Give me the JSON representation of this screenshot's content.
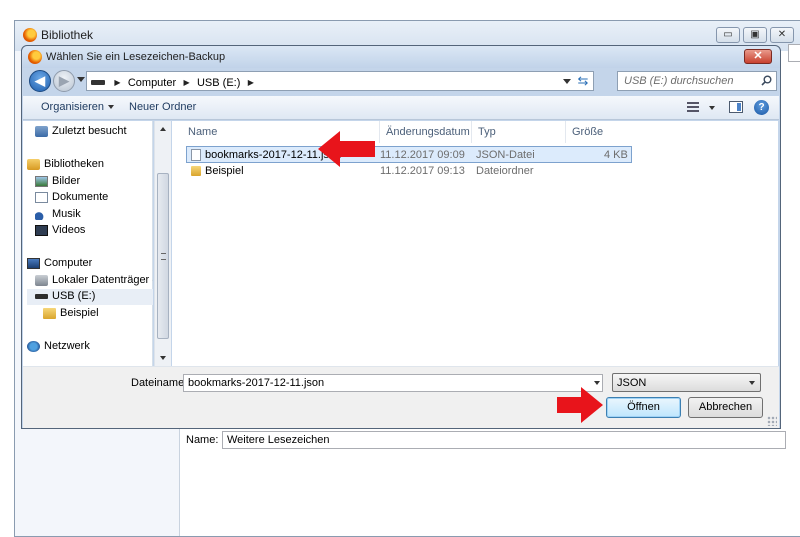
{
  "background_window": {
    "title": "Bibliothek",
    "minimize": "▭",
    "maximize": "▣",
    "close": "✕",
    "name_label": "Name:",
    "name_value": "Weitere Lesezeichen"
  },
  "dialog": {
    "title": "Wählen Sie ein Lesezeichen-Backup",
    "close": "✕",
    "breadcrumb": [
      "Computer",
      "USB (E:)"
    ],
    "search_placeholder": "USB (E:) durchsuchen",
    "toolbar": {
      "organize": "Organisieren",
      "new_folder": "Neuer Ordner",
      "help": "?"
    },
    "nav": {
      "recent": "Zuletzt besucht",
      "libraries": "Bibliotheken",
      "pictures": "Bilder",
      "documents": "Dokumente",
      "music": "Musik",
      "videos": "Videos",
      "computer": "Computer",
      "local_disk": "Lokaler Datenträger (C:)",
      "usb": "USB (E:)",
      "usb_folder": "Beispiel",
      "network": "Netzwerk"
    },
    "columns": {
      "name": "Name",
      "date": "Änderungsdatum",
      "type": "Typ",
      "size": "Größe"
    },
    "files": [
      {
        "name": "bookmarks-2017-12-11.json",
        "date": "11.12.2017 09:09",
        "type": "JSON-Datei",
        "size": "4 KB"
      },
      {
        "name": "Beispiel",
        "date": "11.12.2017 09:13",
        "type": "Dateiordner",
        "size": ""
      }
    ],
    "filename_label": "Dateiname:",
    "filename_value": "bookmarks-2017-12-11.json",
    "filetype": "JSON",
    "open_button": "Öffnen",
    "cancel_button": "Abbrechen"
  },
  "colors": {
    "annotation_arrow": "#e8141b",
    "selection": "#dcebfc",
    "dialog_frame": "#c4d5ea"
  }
}
